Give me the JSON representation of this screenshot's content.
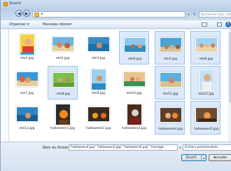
{
  "window": {
    "title": "Ouvrir"
  },
  "addressbar": {
    "search_placeholder": "Rechercher dans : Ecte..."
  },
  "toolbar": {
    "organize": "Organiser ▾",
    "new_folder": "Nouveau dossier"
  },
  "files": [
    {
      "name": "ete1.jpg",
      "selected": true
    },
    {
      "name": "ete2.jpg",
      "selected": false
    },
    {
      "name": "ete3.jpg",
      "selected": false
    },
    {
      "name": "ete4.jpg",
      "selected": true
    },
    {
      "name": "ete5.jpg",
      "selected": true
    },
    {
      "name": "ete6.jpg",
      "selected": true
    },
    {
      "name": "ete7.jpg",
      "selected": false
    },
    {
      "name": "ete8.jpg",
      "selected": true
    },
    {
      "name": "ete9.jpg",
      "selected": false
    },
    {
      "name": "ete10.jpg",
      "selected": false
    },
    {
      "name": "ete11.jpg",
      "selected": true
    },
    {
      "name": "ete12.jpg",
      "selected": true
    },
    {
      "name": "ete13.jpg",
      "selected": false
    },
    {
      "name": "halloween1.jpg",
      "selected": false
    },
    {
      "name": "halloween2.jpg",
      "selected": false
    },
    {
      "name": "halloween3.jpg",
      "selected": false
    },
    {
      "name": "halloween4.jpg",
      "selected": true
    },
    {
      "name": "halloween5.jpg",
      "selected": true
    }
  ],
  "footer": {
    "filename_label": "Nom du fichier :",
    "filename_value": "\"halloween4.jpg\" \"halloween5.jpg\" \"halloween6.jpg\" \"mariage",
    "filetype_value": "Fichiers personnalisés",
    "open_label": "Ouvrir",
    "cancel_label": "Annuler"
  }
}
